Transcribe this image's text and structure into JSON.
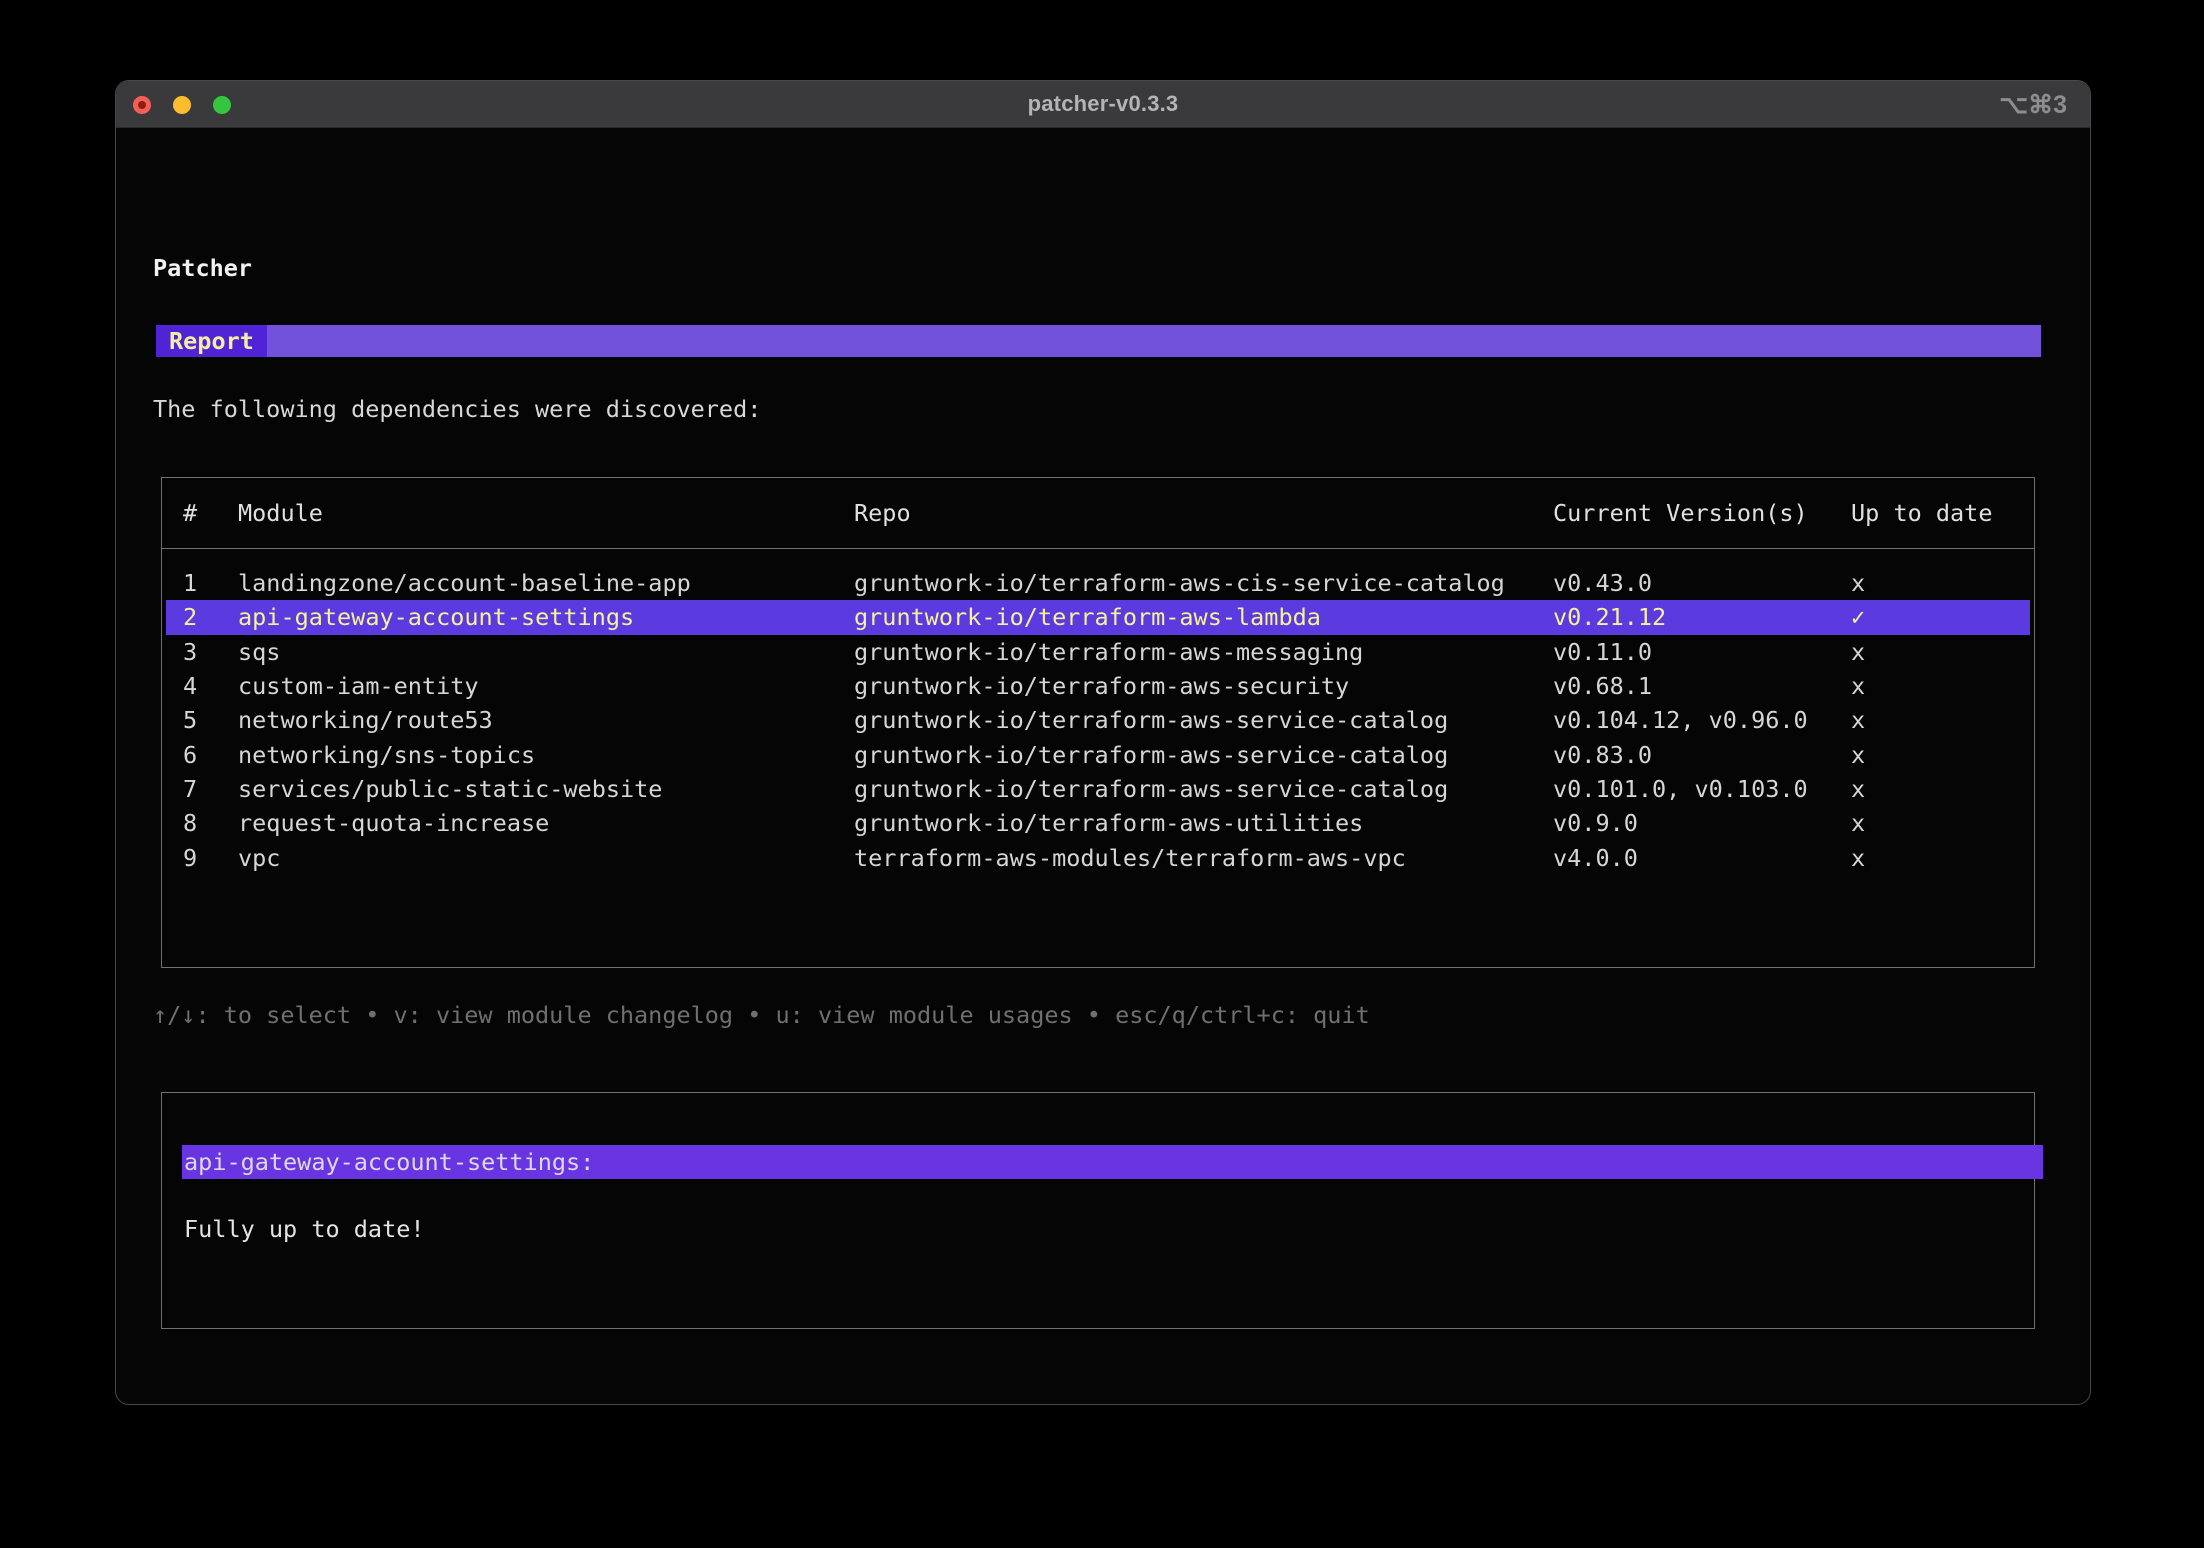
{
  "window": {
    "title": "patcher-v0.3.3",
    "shortcut": "⌥⌘3"
  },
  "app": {
    "heading": "Patcher",
    "tab_label": "Report",
    "intro": "The following dependencies were discovered:",
    "table": {
      "columns": {
        "num": "#",
        "module": "Module",
        "repo": "Repo",
        "versions": "Current Version(s)",
        "status": "Up to date"
      },
      "rows": [
        {
          "num": "1",
          "module": "landingzone/account-baseline-app",
          "repo": "gruntwork-io/terraform-aws-cis-service-catalog",
          "versions": "v0.43.0",
          "status": "x",
          "selected": false
        },
        {
          "num": "2",
          "module": "api-gateway-account-settings",
          "repo": "gruntwork-io/terraform-aws-lambda",
          "versions": "v0.21.12",
          "status": "✓",
          "selected": true
        },
        {
          "num": "3",
          "module": "sqs",
          "repo": "gruntwork-io/terraform-aws-messaging",
          "versions": "v0.11.0",
          "status": "x",
          "selected": false
        },
        {
          "num": "4",
          "module": "custom-iam-entity",
          "repo": "gruntwork-io/terraform-aws-security",
          "versions": "v0.68.1",
          "status": "x",
          "selected": false
        },
        {
          "num": "5",
          "module": "networking/route53",
          "repo": "gruntwork-io/terraform-aws-service-catalog",
          "versions": "v0.104.12, v0.96.0",
          "status": "x",
          "selected": false
        },
        {
          "num": "6",
          "module": "networking/sns-topics",
          "repo": "gruntwork-io/terraform-aws-service-catalog",
          "versions": "v0.83.0",
          "status": "x",
          "selected": false
        },
        {
          "num": "7",
          "module": "services/public-static-website",
          "repo": "gruntwork-io/terraform-aws-service-catalog",
          "versions": "v0.101.0, v0.103.0",
          "status": "x",
          "selected": false
        },
        {
          "num": "8",
          "module": "request-quota-increase",
          "repo": "gruntwork-io/terraform-aws-utilities",
          "versions": "v0.9.0",
          "status": "x",
          "selected": false
        },
        {
          "num": "9",
          "module": "vpc",
          "repo": "terraform-aws-modules/terraform-aws-vpc",
          "versions": "v4.0.0",
          "status": "x",
          "selected": false
        }
      ]
    },
    "help": "↑/↓: to select • v: view module changelog • u: view module usages • esc/q/ctrl+c: quit",
    "detail_panel": {
      "title": "api-gateway-account-settings:",
      "body": "Fully up to date!"
    }
  },
  "colors": {
    "accent_tab": "#4f23d6",
    "accent_bar": "#7252da",
    "accent_row_highlight": "#5b3be0",
    "accent_detail_bar": "#6935e3",
    "selected_text": "#f6f19c",
    "titlebar_bg": "#3a3a3c",
    "border_gray": "#707070",
    "help_text": "#6f6f6f",
    "traffic_red": "#f55f57",
    "traffic_yellow": "#fbbc2e",
    "traffic_green": "#33c63e"
  }
}
